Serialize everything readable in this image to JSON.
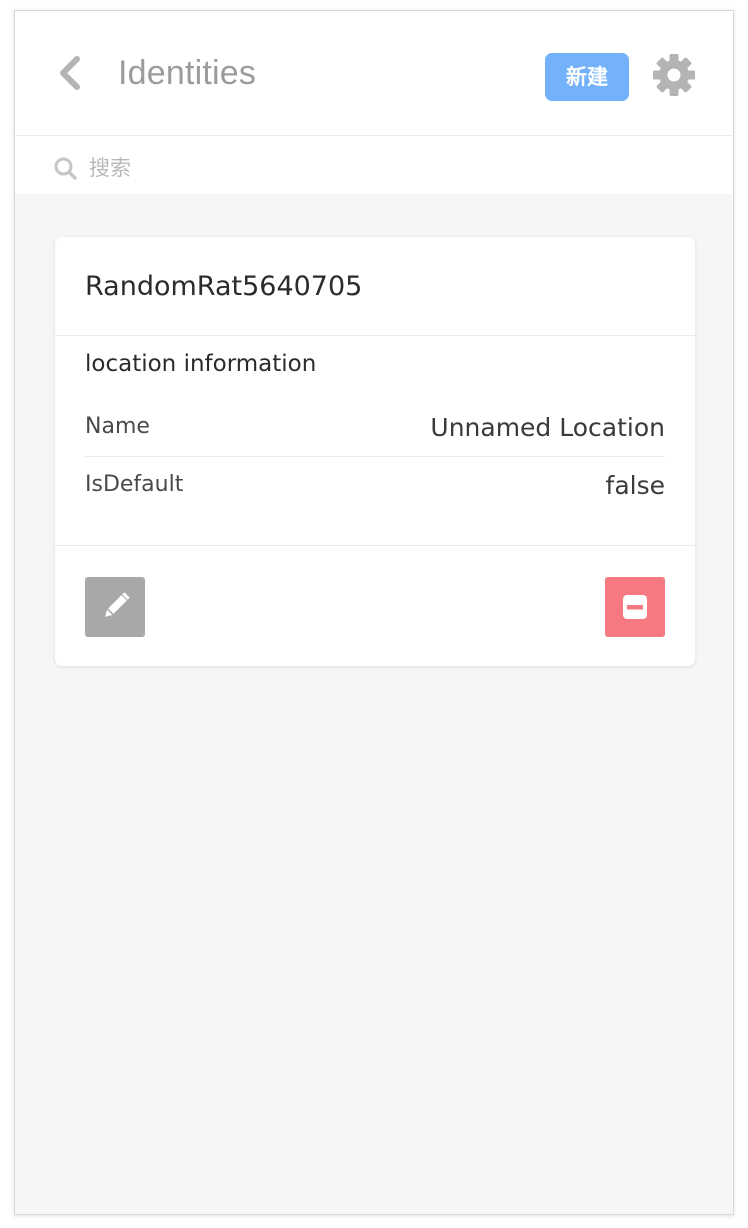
{
  "header": {
    "title": "Identities",
    "new_button_label": "新建",
    "back_icon": "chevron-left-icon",
    "settings_icon": "gear-icon"
  },
  "search": {
    "placeholder": "搜索",
    "value": "",
    "icon": "search-icon"
  },
  "card": {
    "title": "RandomRat5640705",
    "section_title": "location information",
    "rows": [
      {
        "label": "Name",
        "value": "Unnamed Location"
      },
      {
        "label": "IsDefault",
        "value": "false"
      }
    ],
    "edit_icon": "pencil-icon",
    "delete_icon": "minus-square-icon"
  },
  "colors": {
    "accent": "#73b1fb",
    "danger": "#f6797f",
    "neutral_button": "#a8a8a8",
    "background": "#f6f6f6"
  }
}
